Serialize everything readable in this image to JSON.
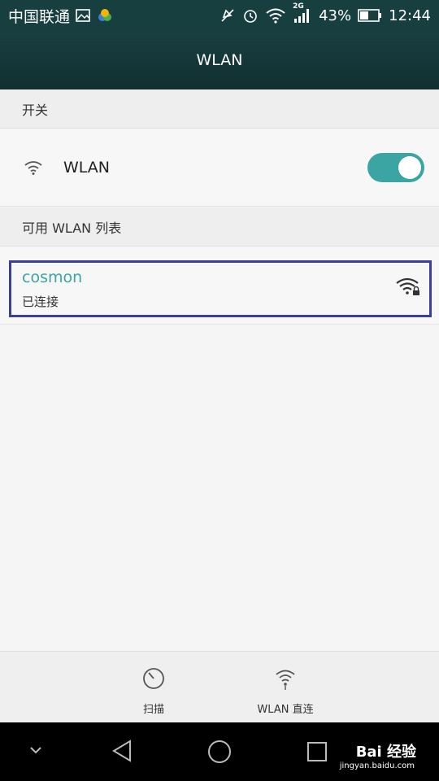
{
  "status_bar": {
    "carrier": "中国联通",
    "network_type": "2G",
    "battery": "43%",
    "time": "12:44",
    "icons": [
      "image-icon",
      "app-icon",
      "mute-icon",
      "alarm-icon",
      "wifi-icon",
      "signal-icon",
      "battery-icon"
    ]
  },
  "title": "WLAN",
  "switch_section": {
    "header": "开关",
    "wlan_label": "WLAN",
    "wlan_enabled": true
  },
  "list_section": {
    "header": "可用 WLAN 列表",
    "networks": [
      {
        "name": "cosmon",
        "status": "已连接",
        "secured": true
      }
    ]
  },
  "actions": {
    "scan": "扫描",
    "wifi_direct": "WLAN 直连"
  },
  "watermark": {
    "brand": "Bai 经验",
    "url": "jingyan.baidu.com"
  },
  "colors": {
    "accent": "#3aa5a3",
    "statusbar": "#183f40",
    "highlight_border": "#3a3f9e"
  }
}
